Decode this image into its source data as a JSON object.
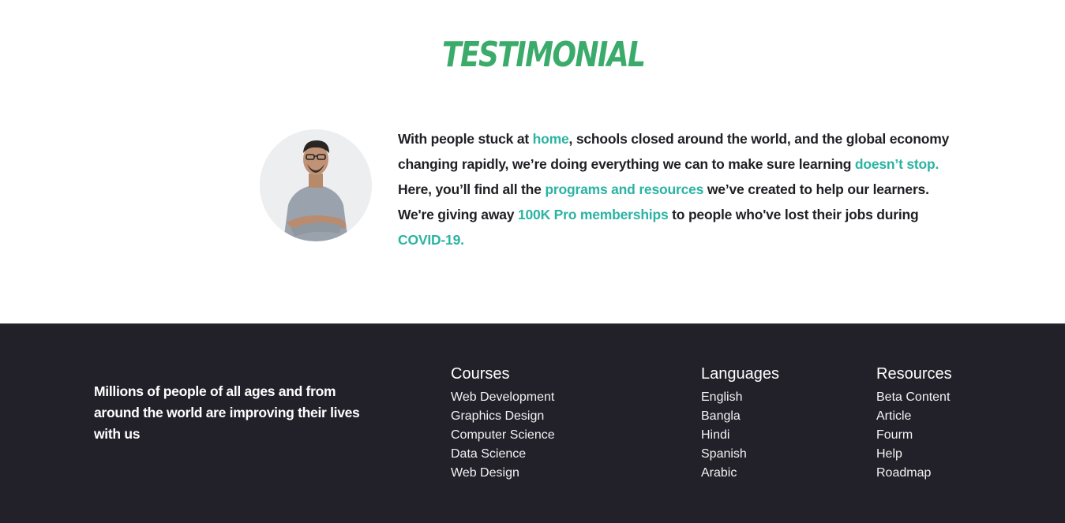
{
  "testimonial": {
    "title": "TESTIMONIAL",
    "quote": [
      {
        "text": "With people stuck at ",
        "highlight": false
      },
      {
        "text": "home",
        "highlight": true
      },
      {
        "text": ", schools closed around the world, and the global economy changing rapidly, we’re doing everything we can to make sure learning ",
        "highlight": false
      },
      {
        "text": "doesn’t stop.",
        "highlight": true
      },
      {
        "text": " Here, you’ll find all the ",
        "highlight": false
      },
      {
        "text": "programs and resources",
        "highlight": true
      },
      {
        "text": " we’ve created to help our learners. We're giving away ",
        "highlight": false
      },
      {
        "text": "100K Pro memberships",
        "highlight": true
      },
      {
        "text": " to people who've lost their jobs during ",
        "highlight": false
      },
      {
        "text": "COVID-19.",
        "highlight": true
      }
    ]
  },
  "footer": {
    "tagline": "Millions of people of all ages and from around the world are improving their lives with us",
    "columns": [
      {
        "heading": "Courses",
        "items": [
          "Web Development",
          "Graphics Design",
          "Computer Science",
          "Data Science",
          "Web Design"
        ]
      },
      {
        "heading": "Languages",
        "items": [
          "English",
          "Bangla",
          "Hindi",
          "Spanish",
          "Arabic"
        ]
      },
      {
        "heading": "Resources",
        "items": [
          "Beta Content",
          "Article",
          "Fourm",
          "Help",
          "Roadmap"
        ]
      }
    ]
  },
  "colors": {
    "title_green": "#3bab6b",
    "highlight_teal": "#2bb3a3",
    "footer_bg": "#22212a",
    "text_dark": "#1f1f24"
  }
}
